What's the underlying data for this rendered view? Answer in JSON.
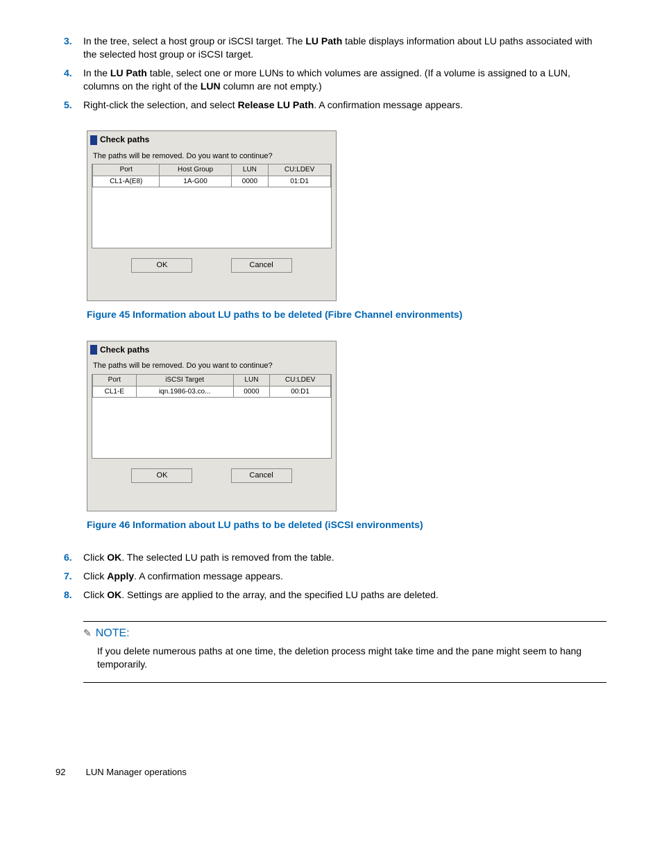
{
  "steps_top": [
    {
      "n": "3.",
      "parts": [
        "In the tree, select a host group or iSCSI target. The ",
        {
          "b": "LU Path"
        },
        " table displays information about LU paths associated with the selected host group or iSCSI target."
      ]
    },
    {
      "n": "4.",
      "parts": [
        "In the ",
        {
          "b": "LU Path"
        },
        " table, select one or more LUNs to which volumes are assigned. (If a volume is assigned to a LUN, columns on the right of the ",
        {
          "b": "LUN"
        },
        " column are not empty.)"
      ]
    },
    {
      "n": "5.",
      "parts": [
        "Right-click the selection, and select ",
        {
          "b": "Release LU Path"
        },
        ". A confirmation message appears."
      ]
    }
  ],
  "dialog1": {
    "title": "Check paths",
    "message": "The paths will be removed. Do you want to continue?",
    "headers": [
      "Port",
      "Host Group",
      "LUN",
      "CU:LDEV"
    ],
    "row": [
      "CL1-A(E8)",
      "1A-G00",
      "0000",
      "01:D1"
    ],
    "ok": "OK",
    "cancel": "Cancel"
  },
  "fig45": "Figure 45 Information about LU paths to be deleted (Fibre Channel environments)",
  "dialog2": {
    "title": "Check paths",
    "message": "The paths will be removed. Do you want to continue?",
    "headers": [
      "Port",
      "iSCSI Target",
      "LUN",
      "CU:LDEV"
    ],
    "row": [
      "CL1-E",
      "iqn.1986-03.co...",
      "0000",
      "00:D1"
    ],
    "ok": "OK",
    "cancel": "Cancel"
  },
  "fig46": "Figure 46 Information about LU paths to be deleted (iSCSI environments)",
  "steps_bottom": [
    {
      "n": "6.",
      "parts": [
        "Click ",
        {
          "b": "OK"
        },
        ". The selected LU path is removed from the table."
      ]
    },
    {
      "n": "7.",
      "parts": [
        "Click ",
        {
          "b": "Apply"
        },
        ". A confirmation message appears."
      ]
    },
    {
      "n": "8.",
      "parts": [
        "Click ",
        {
          "b": "OK"
        },
        ". Settings are applied to the array, and the specified LU paths are deleted."
      ]
    }
  ],
  "note": {
    "head": "NOTE:",
    "body": "If you delete numerous paths at one time, the deletion process might take time and the pane might seem to hang temporarily."
  },
  "footer": {
    "page": "92",
    "section": "LUN Manager operations"
  }
}
